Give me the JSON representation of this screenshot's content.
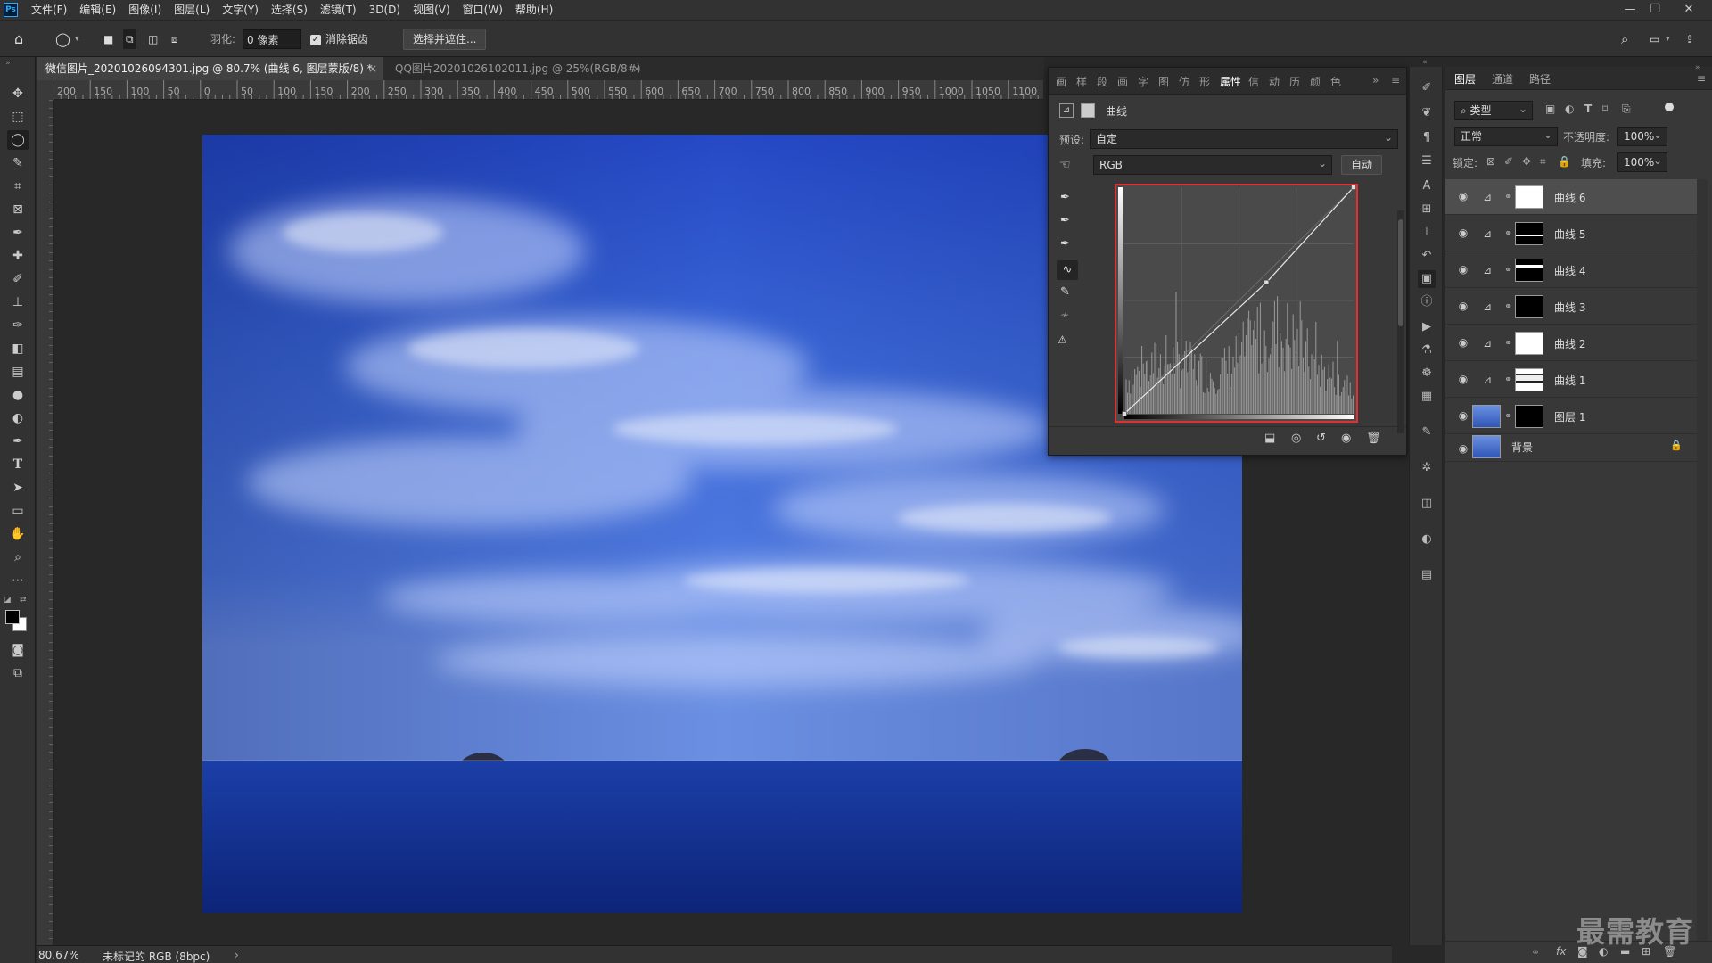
{
  "app": {
    "logo": "Ps",
    "window_controls": [
      "—",
      "❐",
      "✕"
    ]
  },
  "menu": [
    "文件(F)",
    "编辑(E)",
    "图像(I)",
    "图层(L)",
    "文字(Y)",
    "选择(S)",
    "滤镜(T)",
    "3D(D)",
    "视图(V)",
    "窗口(W)",
    "帮助(H)"
  ],
  "options": {
    "feather_label": "羽化:",
    "feather_value": "0 像素",
    "antialias_label": "消除锯齿",
    "select_mask_button": "选择并遮住..."
  },
  "tabs": [
    {
      "label": "微信图片_20201026094301.jpg @ 80.7% (曲线 6, 图层蒙版/8) *",
      "active": true
    },
    {
      "label": "QQ图片20201026102011.jpg @ 25%(RGB/8#)",
      "active": false
    }
  ],
  "ruler_h": [
    "200",
    "150",
    "100",
    "50",
    "0",
    "50",
    "100",
    "150",
    "200",
    "250",
    "300",
    "350",
    "400",
    "450",
    "500",
    "550",
    "600",
    "650",
    "700",
    "750",
    "800",
    "850",
    "900",
    "950",
    "1000",
    "1050",
    "1100",
    "11"
  ],
  "status": {
    "zoom": "80.67%",
    "doc_info": "未标记的 RGB (8bpc)",
    "arrow": "›"
  },
  "properties": {
    "tabs": [
      "画",
      "样",
      "段",
      "画",
      "字",
      "图",
      "仿",
      "形",
      "属性",
      "信",
      "动",
      "历",
      "颜",
      "色"
    ],
    "active_tab": "属性",
    "expand": "»",
    "panel_title": "曲线",
    "preset_label": "预设:",
    "preset_value": "自定",
    "channel_value": "RGB",
    "auto_button": "自动",
    "curve_points": [
      [
        0,
        0
      ],
      [
        0.62,
        0.58
      ],
      [
        1,
        1
      ]
    ]
  },
  "layers_panel": {
    "tabs": [
      "图层",
      "通道",
      "路径"
    ],
    "filter_value": "类型",
    "blend_mode": "正常",
    "opacity_label": "不透明度:",
    "opacity_value": "100%",
    "lock_label": "锁定:",
    "fill_label": "填充:",
    "fill_value": "100%",
    "layers": [
      {
        "name": "曲线 6",
        "type": "curves",
        "mask": "white",
        "selected": true
      },
      {
        "name": "曲线 5",
        "type": "curves",
        "mask": "black-top"
      },
      {
        "name": "曲线 4",
        "type": "curves",
        "mask": "black-mid"
      },
      {
        "name": "曲线 3",
        "type": "curves",
        "mask": "black"
      },
      {
        "name": "曲线 2",
        "type": "curves",
        "mask": "white"
      },
      {
        "name": "曲线 1",
        "type": "curves",
        "mask": "clouds"
      },
      {
        "name": "图层 1",
        "type": "pixel",
        "mask": "black"
      },
      {
        "name": "背景",
        "type": "background",
        "locked": true
      }
    ]
  },
  "watermark": "最需教育",
  "colors": {
    "accent_red": "#e0302f",
    "panel_bg": "#383838",
    "app_bg": "#323232"
  }
}
